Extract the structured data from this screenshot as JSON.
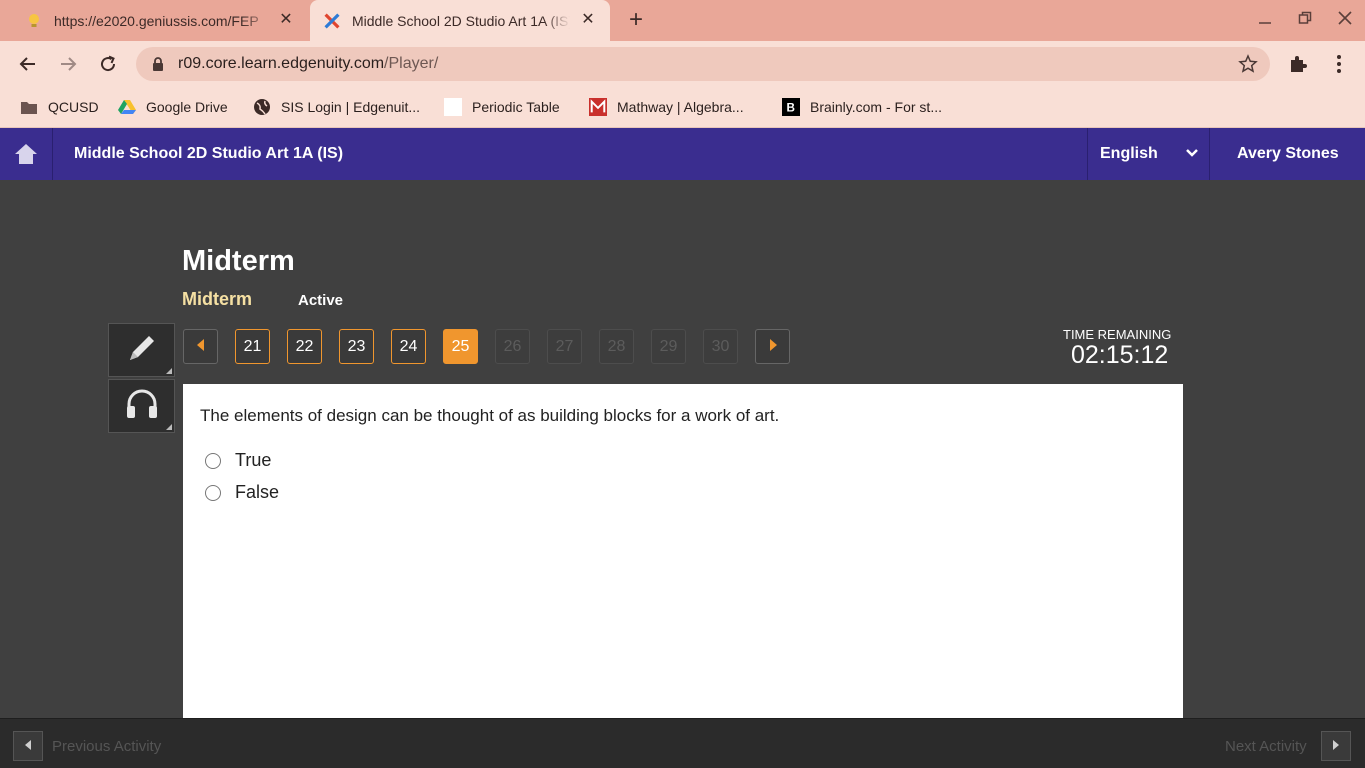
{
  "browser": {
    "tabs": [
      {
        "title": "https://e2020.geniussis.com/FEP",
        "icon": "lightbulb-icon"
      },
      {
        "title": "Middle School 2D Studio Art 1A (IS)",
        "icon": "edgenuity-x-icon",
        "active": true
      }
    ],
    "address": {
      "host": "r09.core.learn.edgenuity.com",
      "path": "/Player/"
    },
    "bookmarks": [
      {
        "label": "QCUSD",
        "icon": "folder-icon"
      },
      {
        "label": "Google Drive",
        "icon": "google-drive-icon"
      },
      {
        "label": "SIS Login | Edgenuit...",
        "icon": "globe-icon"
      },
      {
        "label": "Periodic Table",
        "icon": "blank-page-icon"
      },
      {
        "label": "Mathway | Algebra...",
        "icon": "mathway-icon"
      },
      {
        "label": "Brainly.com - For st...",
        "icon": "brainly-icon"
      }
    ]
  },
  "header": {
    "course_title": "Middle School 2D Studio Art 1A (IS)",
    "language": "English",
    "user": "Avery Stones"
  },
  "activity": {
    "title": "Midterm",
    "subtitle": "Midterm",
    "status": "Active"
  },
  "question_nav": {
    "items": [
      {
        "label": "21",
        "state": "done"
      },
      {
        "label": "22",
        "state": "done"
      },
      {
        "label": "23",
        "state": "done"
      },
      {
        "label": "24",
        "state": "done"
      },
      {
        "label": "25",
        "state": "current"
      },
      {
        "label": "26",
        "state": "locked"
      },
      {
        "label": "27",
        "state": "locked"
      },
      {
        "label": "28",
        "state": "locked"
      },
      {
        "label": "29",
        "state": "locked"
      },
      {
        "label": "30",
        "state": "locked"
      }
    ]
  },
  "timer": {
    "label": "TIME REMAINING",
    "value": "02:15:12"
  },
  "question": {
    "text": "The elements of design can be thought of as building blocks for a work of art.",
    "options": [
      "True",
      "False"
    ]
  },
  "footer": {
    "previous": "Previous Activity",
    "next": "Next Activity"
  },
  "colors": {
    "header_purple": "#3a2d8f",
    "accent_orange": "#f0962e",
    "subtitle_yellow": "#f5e0a3",
    "tabstrip_pink": "#e9a798"
  }
}
